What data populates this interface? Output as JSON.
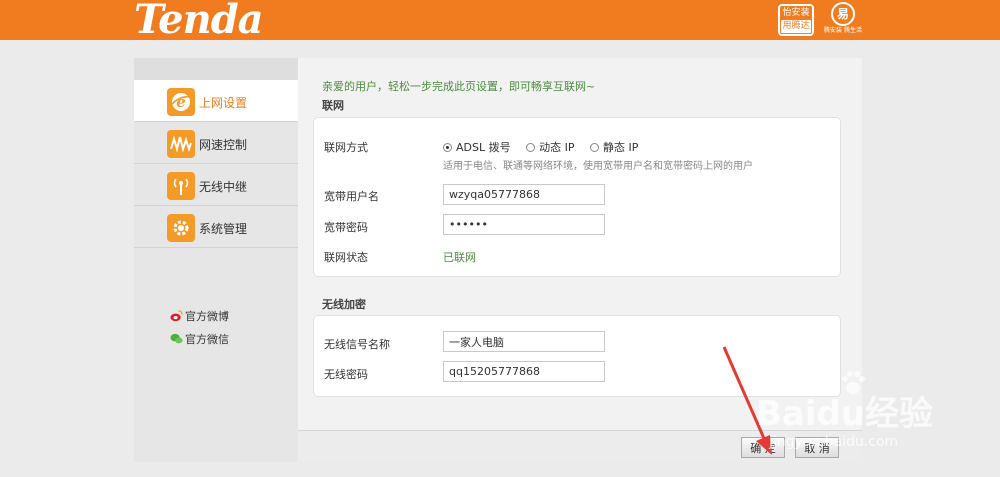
{
  "header": {
    "logo": "Tenda",
    "badge_line1": "怡安装",
    "badge_line2": "用腾达",
    "badge2_mark": "易",
    "badge2_caption": "腾安装 腾生活"
  },
  "sidebar": {
    "items": [
      {
        "label": "上网设置",
        "icon": "internet-e-icon",
        "active": true
      },
      {
        "label": "网速控制",
        "icon": "speed-wave-icon",
        "active": false
      },
      {
        "label": "无线中继",
        "icon": "wireless-repeater-icon",
        "active": false
      },
      {
        "label": "系统管理",
        "icon": "gear-icon",
        "active": false
      }
    ],
    "weibo": "官方微博",
    "wechat": "官方微信"
  },
  "main": {
    "welcome": "亲爱的用户，轻松一步完成此页设置，即可畅享互联网~",
    "internet_title": "联网",
    "conn_type_label": "联网方式",
    "conn_options": [
      "ADSL 拨号",
      "动态 IP",
      "静态 IP"
    ],
    "conn_selected": "ADSL 拨号",
    "conn_hint": "适用于电信、联通等网络环境，使用宽带用户名和宽带密码上网的用户",
    "username_label": "宽带用户名",
    "username_value": "wzyqa05777868",
    "password_label": "宽带密码",
    "password_value": "••••••",
    "status_label": "联网状态",
    "status_value": "已联网",
    "wireless_title": "无线加密",
    "ssid_label": "无线信号名称",
    "ssid_value": "一家人电脑",
    "wifi_pwd_label": "无线密码",
    "wifi_pwd_value": "qq15205777868"
  },
  "footer": {
    "confirm": "确 定",
    "cancel": "取 消"
  },
  "watermark": {
    "brand": "Baidu经验",
    "url": "jingyan.baidu.com"
  },
  "colors": {
    "brand_orange": "#f07c1f",
    "status_green": "#4d8a3f",
    "annotation_red": "#e53935"
  }
}
